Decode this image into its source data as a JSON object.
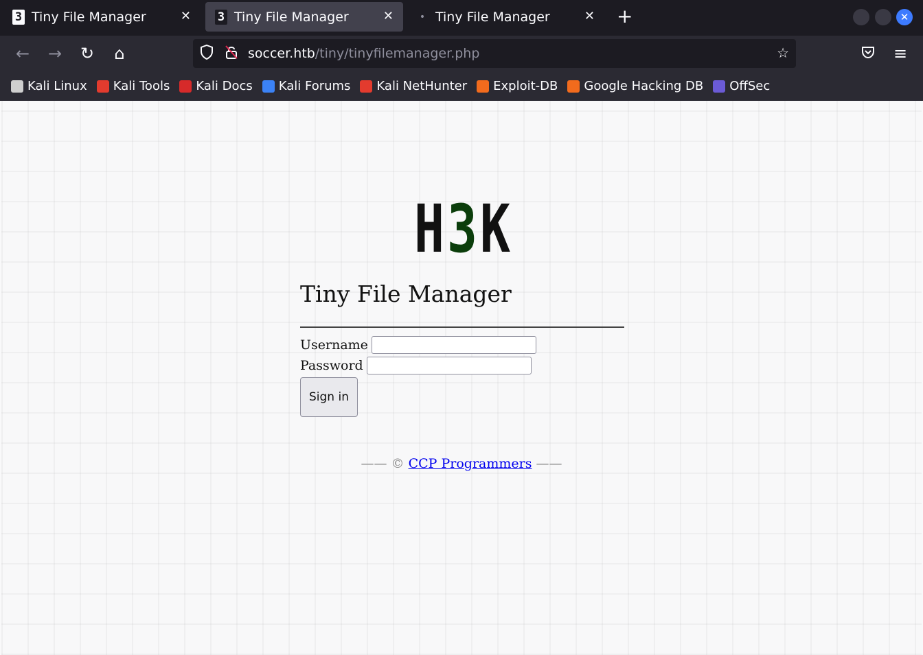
{
  "tabs": [
    {
      "title": "Tiny File Manager",
      "favicon": "3",
      "active": false
    },
    {
      "title": "Tiny File Manager",
      "favicon": "3",
      "active": true
    },
    {
      "title": "Tiny File Manager",
      "favicon": "",
      "active": false
    }
  ],
  "url": {
    "host": "soccer.htb",
    "path": "/tiny/tinyfilemanager.php"
  },
  "bookmarks": [
    {
      "label": "Kali Linux",
      "icon": "kali-dragon-icon",
      "color": "#cfcfcf"
    },
    {
      "label": "Kali Tools",
      "icon": "kali-tools-icon",
      "color": "#e33b2e"
    },
    {
      "label": "Kali Docs",
      "icon": "kali-docs-icon",
      "color": "#d62a2a"
    },
    {
      "label": "Kali Forums",
      "icon": "kali-forums-icon",
      "color": "#3b82f6"
    },
    {
      "label": "Kali NetHunter",
      "icon": "kali-nethunter-icon",
      "color": "#e33b2e"
    },
    {
      "label": "Exploit-DB",
      "icon": "exploit-db-icon",
      "color": "#f26b1d"
    },
    {
      "label": "Google Hacking DB",
      "icon": "ghdb-icon",
      "color": "#f26b1d"
    },
    {
      "label": "OffSec",
      "icon": "offsec-icon",
      "color": "#6b5bd6"
    }
  ],
  "page": {
    "logo": {
      "h": "H",
      "three": "3",
      "k": "K",
      "three_color": "#0b3d0b"
    },
    "title": "Tiny File Manager",
    "username_label": "Username",
    "password_label": "Password",
    "signin_label": "Sign in",
    "footer_prefix": "—— ©",
    "footer_link": "CCP Programmers",
    "footer_suffix": "——"
  }
}
